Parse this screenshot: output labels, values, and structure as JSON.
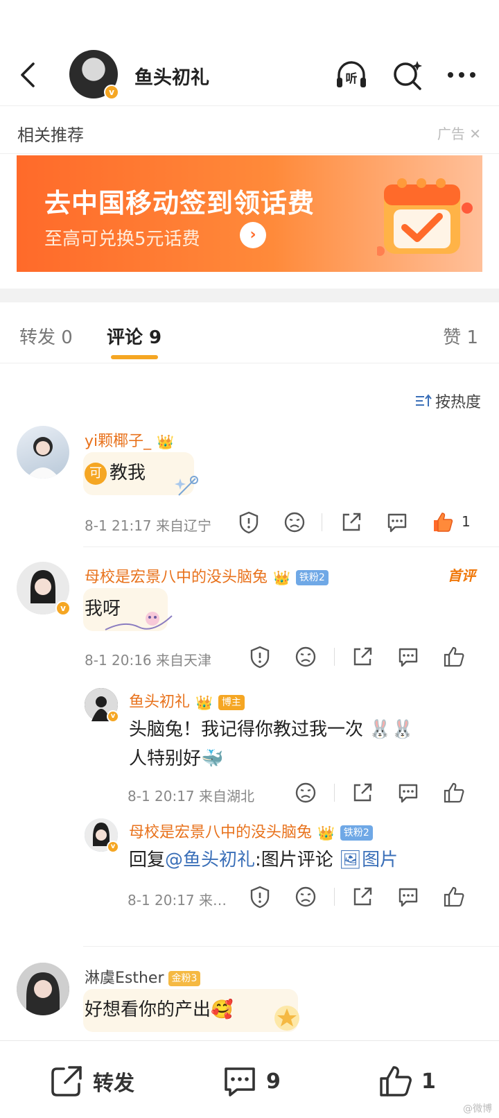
{
  "header": {
    "title": "鱼头初礼",
    "verified_mark": "v"
  },
  "recommend": {
    "title": "相关推荐",
    "ad_label": "广告",
    "close_symbol": "✕"
  },
  "banner": {
    "headline": "去中国移动签到领话费",
    "subline": "至高可兑换5元话费",
    "arrow": "›"
  },
  "tabs": [
    {
      "label": "转发 0"
    },
    {
      "label": "评论 9"
    },
    {
      "label": "赞 1"
    }
  ],
  "sort": {
    "label": "按热度"
  },
  "comments": [
    {
      "name": "yi颗椰子_",
      "ke_icon": "可",
      "text": "教我",
      "meta": "8-1 21:17  来自辽宁",
      "likes": "1"
    },
    {
      "name": "母校是宏景八中的没头脑兔",
      "badge": "铁粉2",
      "first_tag": "首评",
      "text": "我呀",
      "meta": "8-1 20:16  来自天津",
      "replies": [
        {
          "name": "鱼头初礼",
          "badge": "博主",
          "text_line1": "头脑兔！我记得你教过我一次 🐰🐰",
          "text_line2": "人特别好🐳",
          "meta": "8-1 20:17  来自湖北"
        },
        {
          "name": "母校是宏景八中的没头脑兔",
          "badge": "铁粉2",
          "reply_prefix": "回复",
          "mention": "@鱼头初礼",
          "reply_body": ":图片评论 ",
          "image_link": "🖼图片",
          "meta": "8-1 20:17  来…"
        }
      ]
    },
    {
      "name": "淋虞Esther",
      "badge": "金粉3",
      "text": "好想看你的产出🥰"
    }
  ],
  "bottombar": {
    "repost_label": "转发",
    "comment_count": "9",
    "like_count": "1"
  },
  "watermark": "@微博",
  "colors": {
    "accent": "#f5a623",
    "name_orange": "#e8721c",
    "link_blue": "#3a6fb8",
    "banner_orange": "#ff6a2a"
  }
}
